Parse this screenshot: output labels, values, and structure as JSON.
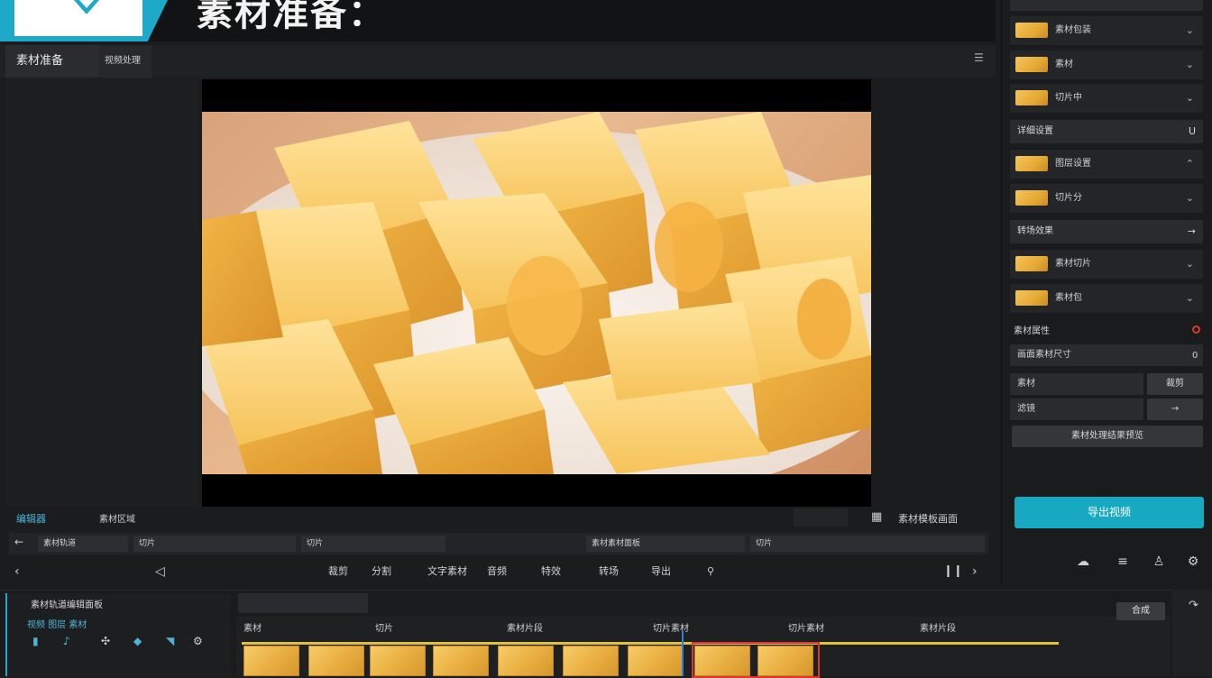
{
  "header": {
    "title": "素材准备："
  },
  "tabs": {
    "tab1": "素材准备",
    "tab2": "视频处理"
  },
  "right_panel": {
    "items": [
      {
        "label": "素材包装",
        "chev": "⌄"
      },
      {
        "label": "素材",
        "chev": "⌄"
      },
      {
        "label": "切片中",
        "chev": "⌄"
      }
    ],
    "section1": {
      "label": "详细设置",
      "chev": "U"
    },
    "items2": [
      {
        "label": "图层设置",
        "chev": "⌃"
      },
      {
        "label": "切片分",
        "chev": "⌄"
      }
    ],
    "section2": {
      "label": "转场效果",
      "chev": "→"
    },
    "items3": [
      {
        "label": "素材切片",
        "chev": "⌄"
      },
      {
        "label": "素材包",
        "chev": "⌄"
      }
    ],
    "props_title": "素材属性",
    "props_row": "画面素材尺寸",
    "props_value": "0",
    "field1": "素材",
    "field1_btn": "裁剪",
    "field2": "滤镜",
    "field2_btn": "→",
    "wide_btn": "素材处理结果预览",
    "export_label": "导出视频"
  },
  "toolbar": {
    "left_label1": "编辑器",
    "left_label2": "素材区域",
    "right_label": "素材模板画面",
    "seg1": "素材轨道",
    "seg2": "切片",
    "seg3": "切片",
    "seg4": "素材素材面板",
    "seg5": "切片",
    "tools": [
      "裁剪",
      "分割",
      "文字素材",
      "音频",
      "特效",
      "转场",
      "导出"
    ]
  },
  "timeline": {
    "left_title": "素材轨道编辑面板",
    "left_sub": "视频 图层 素材",
    "btn": "合成",
    "markers": [
      "素材",
      "切片",
      "素材片段",
      "切片素材",
      "切片素材",
      "素材片段"
    ]
  },
  "colors": {
    "accent": "#1ea9c8",
    "selection": "#e0352b",
    "track_marker": "#e0c23a"
  }
}
